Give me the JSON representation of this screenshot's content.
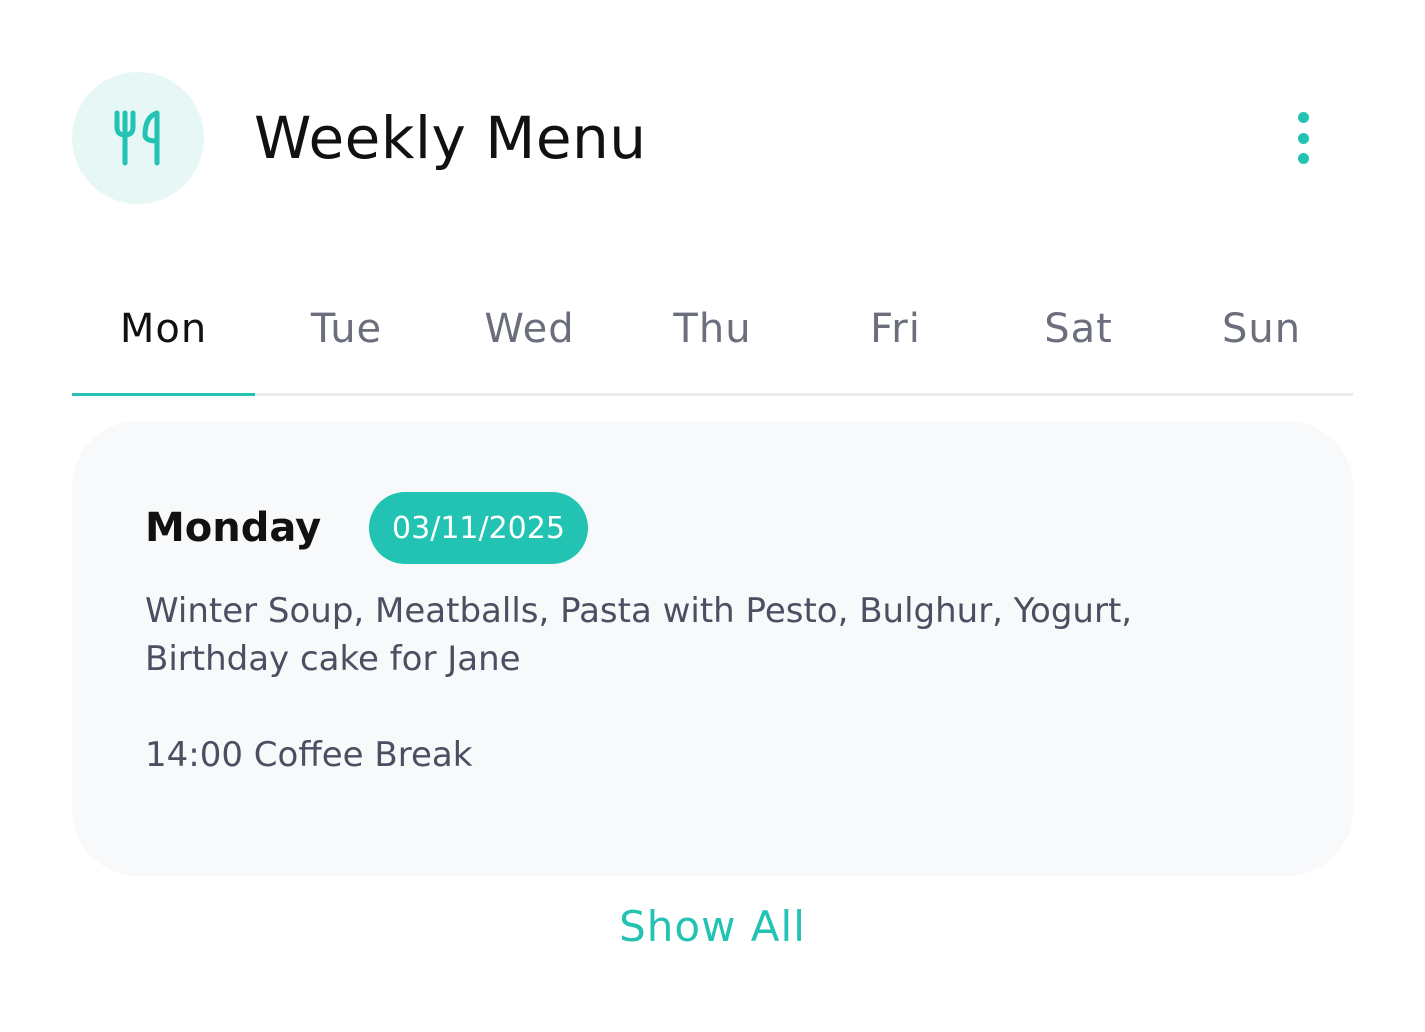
{
  "header": {
    "title": "Weekly Menu",
    "logo_icon": "cutlery-icon",
    "more_icon": "more-vertical-icon"
  },
  "tabs": [
    {
      "label": "Mon",
      "active": true
    },
    {
      "label": "Tue",
      "active": false
    },
    {
      "label": "Wed",
      "active": false
    },
    {
      "label": "Thu",
      "active": false
    },
    {
      "label": "Fri",
      "active": false
    },
    {
      "label": "Sat",
      "active": false
    },
    {
      "label": "Sun",
      "active": false
    }
  ],
  "day": {
    "name": "Monday",
    "date": "03/11/2025",
    "menu": "Winter Soup, Meatballs, Pasta with Pesto, Bulghur, Yogurt, Birthday cake for Jane",
    "break": "14:00 Coffee Break"
  },
  "footer": {
    "show_all_label": "Show All"
  },
  "colors": {
    "accent": "#22c3b2",
    "logo_bg": "#e6f7f5",
    "panel_bg": "#f7f9fa"
  }
}
